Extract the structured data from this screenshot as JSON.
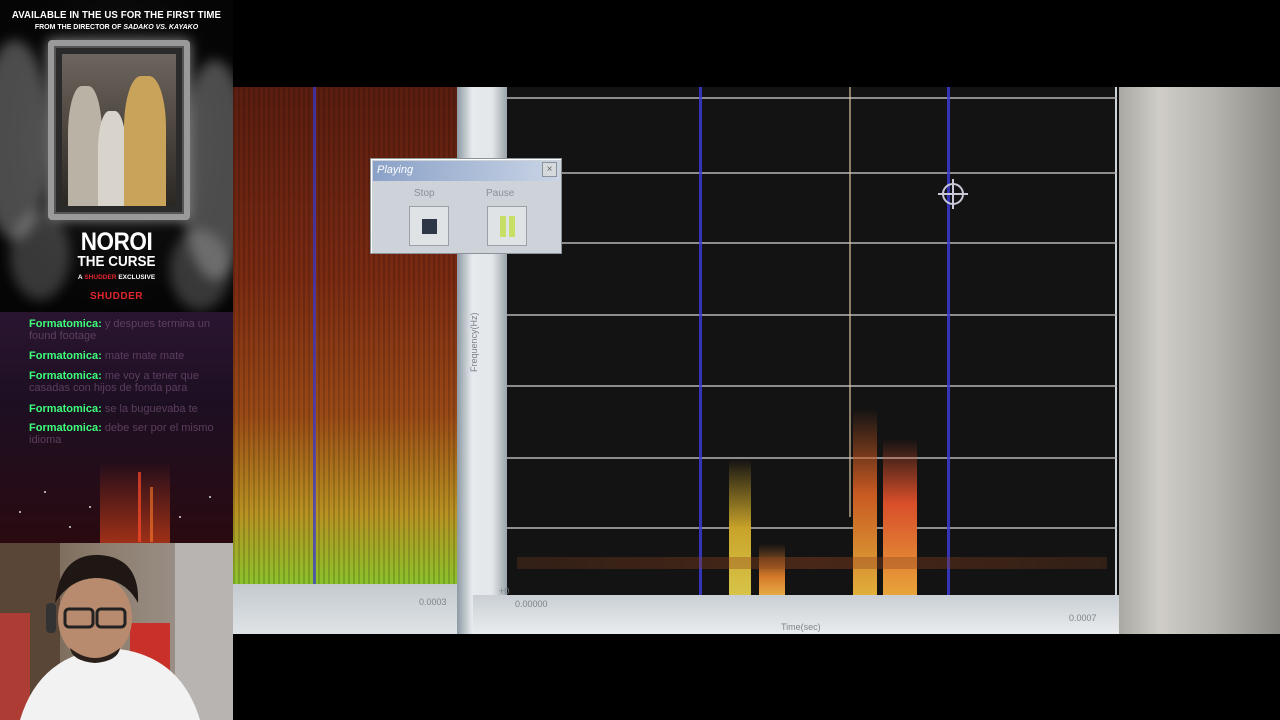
{
  "promo": {
    "headline": "AVAILABLE IN THE US FOR THE FIRST TIME",
    "sub_prefix": "FROM THE DIRECTOR OF",
    "sub_film": "SADAKO VS. KAYAKO",
    "title_line1": "NOROI",
    "title_line2": "THE CURSE",
    "exclusive_prefix": "A",
    "exclusive_brand": "SHUDDER",
    "exclusive_suffix": "EXCLUSIVE",
    "brand": "SHUDDER"
  },
  "chat": {
    "messages": [
      {
        "user": "Formatomica:",
        "text": "y despues termina un found footage"
      },
      {
        "user": "Formatomica:",
        "text": "mate mate mate"
      },
      {
        "user": "Formatomica:",
        "text": "me voy a tener que casadas con hijos de fonda para"
      },
      {
        "user": "Formatomica:",
        "text": "se la buguevaba te"
      },
      {
        "user": "Formatomica:",
        "text": "debe ser por el mismo idioma"
      }
    ]
  },
  "video": {
    "dialog": {
      "title": "Playing",
      "close": "×",
      "stop_label": "Stop",
      "pause_label": "Pause"
    },
    "axis": {
      "freq_label": "Frequency(Hz)",
      "left_tick": "0.0003",
      "zero_tick": "0.00000",
      "right_tick": "0.0007",
      "time_label": "Time(sec)",
      "small_tick": "+0"
    }
  },
  "colors": {
    "chat_user": "#3dff7a",
    "shudder_red": "#e0252d",
    "grid_blue": "#3b3bd6"
  }
}
